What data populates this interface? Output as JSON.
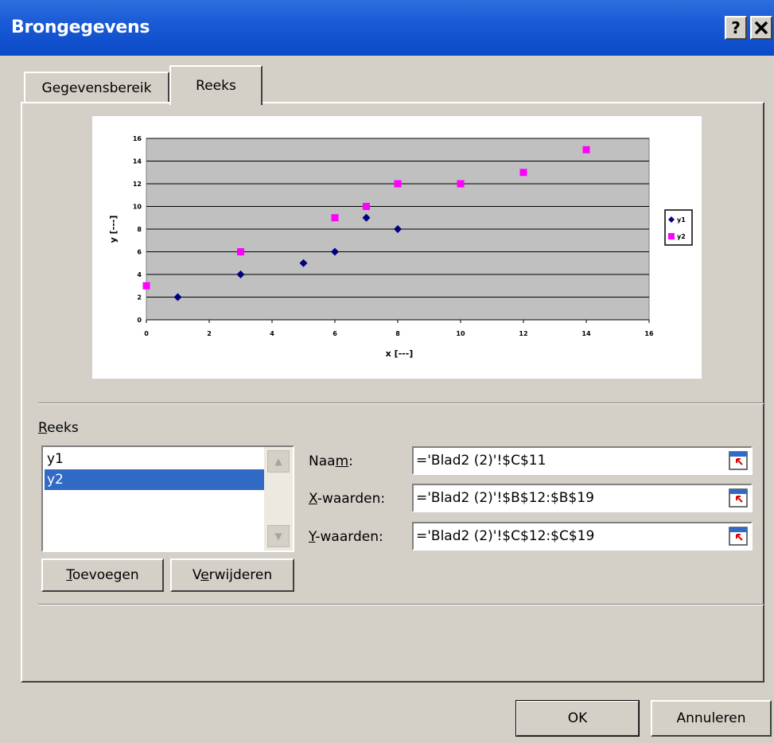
{
  "window": {
    "title": "Brongegevens",
    "help_label": "?",
    "close_label": "×"
  },
  "tabs": [
    {
      "label": "Gegevensbereik",
      "active": false
    },
    {
      "label": "Reeks",
      "active": true
    }
  ],
  "chart_data": {
    "type": "scatter",
    "xlabel": "x [---]",
    "ylabel": "y [---]",
    "xlim": [
      0,
      16
    ],
    "ylim": [
      0,
      16
    ],
    "x_ticks": [
      "0",
      "2",
      "4",
      "6",
      "8",
      "10",
      "12",
      "14",
      "16"
    ],
    "y_ticks": [
      "0",
      "2",
      "4",
      "6",
      "8",
      "10",
      "12",
      "14",
      "16"
    ],
    "grid": "horizontal",
    "legend_position": "right",
    "plot_background": "#c0c0c0",
    "series": [
      {
        "name": "y1",
        "marker": "diamond",
        "color": "#000080",
        "points": [
          [
            1,
            2
          ],
          [
            3,
            4
          ],
          [
            5,
            5
          ],
          [
            6,
            6
          ],
          [
            7,
            9
          ],
          [
            8,
            8
          ]
        ]
      },
      {
        "name": "y2",
        "marker": "square",
        "color": "#ff00ff",
        "points": [
          [
            0,
            3
          ],
          [
            3,
            6
          ],
          [
            6,
            9
          ],
          [
            7,
            10
          ],
          [
            8,
            12
          ],
          [
            10,
            12
          ],
          [
            12,
            13
          ],
          [
            14,
            15
          ]
        ]
      }
    ]
  },
  "series_panel": {
    "label": "Reeks",
    "items": [
      "y1",
      "y2"
    ],
    "selected": "y2",
    "add_button": "Toevoegen",
    "remove_button": "Verwijderen"
  },
  "fields": {
    "name_label": "Naam:",
    "name_value": "='Blad2 (2)'!$C$11",
    "x_label": "X-waarden:",
    "x_value": "='Blad2 (2)'!$B$12:$B$19",
    "y_label": "Y-waarden:",
    "y_value": "='Blad2 (2)'!$C$12:$C$19"
  },
  "footer": {
    "ok_button": "OK",
    "cancel_button": "Annuleren"
  }
}
